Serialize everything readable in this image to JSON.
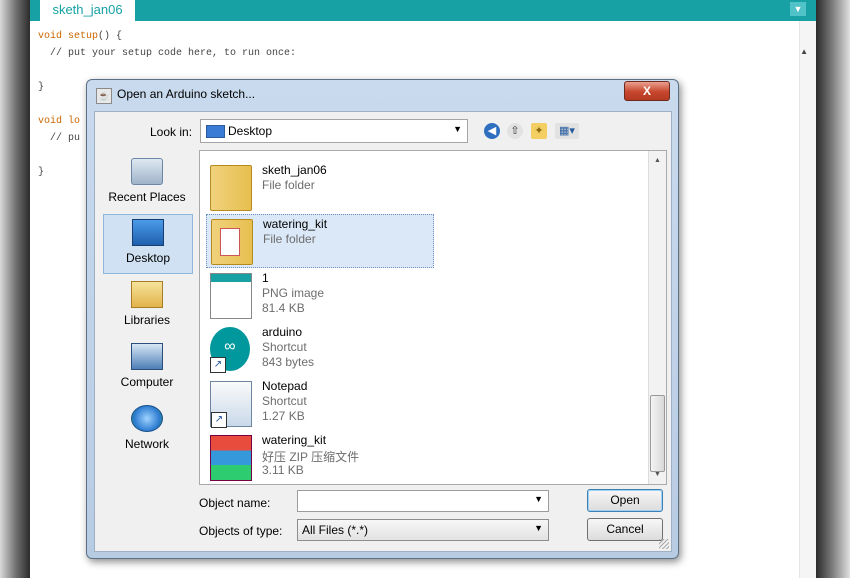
{
  "editor": {
    "tab_label": "sketh_jan06",
    "code_lines": [
      {
        "kw": "void",
        "fn": "setup",
        "rest": "() {"
      },
      {
        "text": "  // put your setup code here, to run once:"
      },
      {
        "text": ""
      },
      {
        "text": "}"
      },
      {
        "text": ""
      },
      {
        "kw": "void",
        "fn": "lo",
        "rest": ""
      },
      {
        "text": "  // pu"
      },
      {
        "text": ""
      },
      {
        "text": "}"
      }
    ]
  },
  "dialog": {
    "title": "Open an Arduino sketch...",
    "close_label": "X",
    "lookin_label": "Look in:",
    "lookin_value": "Desktop",
    "toolbar_icons": [
      "back-icon",
      "up-folder-icon",
      "new-folder-icon",
      "view-menu-icon"
    ],
    "places": [
      {
        "label": "Recent Places",
        "icon": "recent-places-icon",
        "selected": false
      },
      {
        "label": "Desktop",
        "icon": "desktop-icon",
        "selected": true
      },
      {
        "label": "Libraries",
        "icon": "libraries-icon",
        "selected": false
      },
      {
        "label": "Computer",
        "icon": "computer-icon",
        "selected": false
      },
      {
        "label": "Network",
        "icon": "network-icon",
        "selected": false
      }
    ],
    "files": [
      {
        "name": "sketh_jan06",
        "type": "File folder",
        "size": "",
        "icon": "folder-icon",
        "selected": false
      },
      {
        "name": "watering_kit",
        "type": "File folder",
        "size": "",
        "icon": "folder-icon",
        "selected": true
      },
      {
        "name": "1",
        "type": "PNG image",
        "size": "81.4 KB",
        "icon": "png-image-icon",
        "selected": false
      },
      {
        "name": "arduino",
        "type": "Shortcut",
        "size": "843 bytes",
        "icon": "arduino-icon",
        "selected": false
      },
      {
        "name": "Notepad",
        "type": "Shortcut",
        "size": "1.27 KB",
        "icon": "notepad-icon",
        "selected": false
      },
      {
        "name": "watering_kit",
        "type": "好压 ZIP 压缩文件",
        "size": "3.11 KB",
        "icon": "zip-archive-icon",
        "selected": false
      }
    ],
    "object_name_label": "Object name:",
    "object_name_value": "",
    "objects_type_label": "Objects of type:",
    "objects_type_value": "All Files (*.*)",
    "open_label": "Open",
    "cancel_label": "Cancel"
  }
}
